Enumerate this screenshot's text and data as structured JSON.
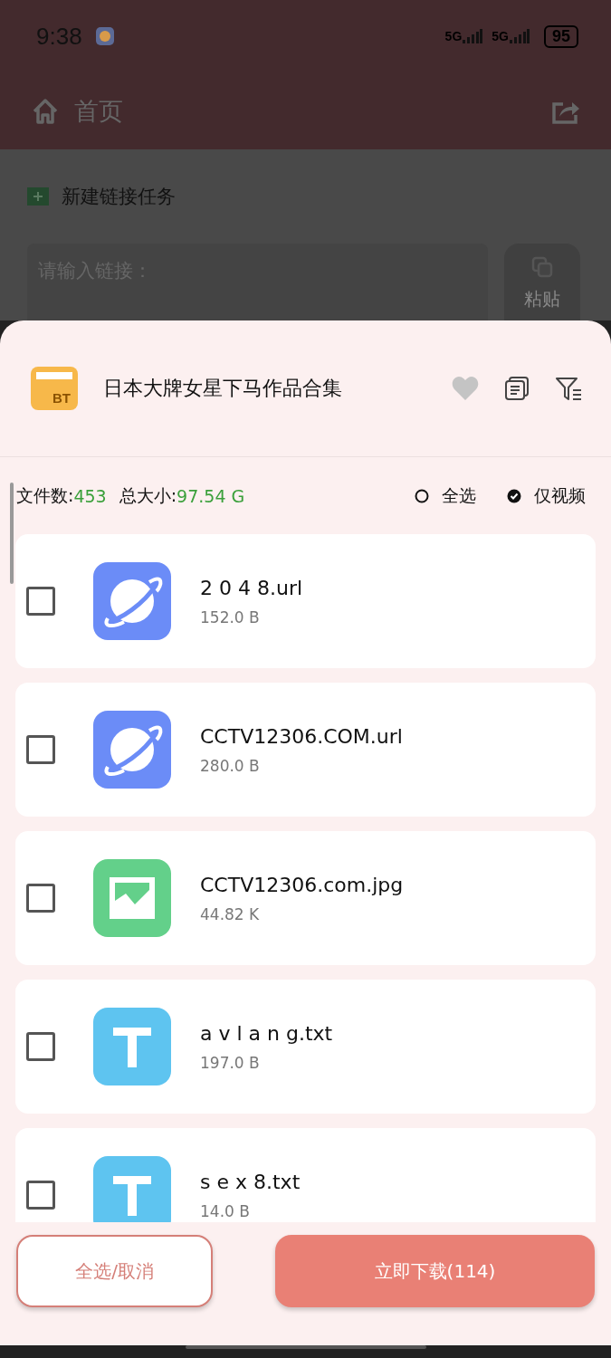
{
  "status_bar": {
    "time": "9:38",
    "networks": [
      "5G",
      "5G"
    ],
    "battery": "95"
  },
  "app_bar": {
    "title": "首页"
  },
  "new_task": {
    "title": "新建链接任务",
    "input": {
      "placeholder": "请输入链接："
    },
    "paste_button": "粘贴"
  },
  "sheet": {
    "icon_label": "BT",
    "title": "日本大牌女星下马作品合集",
    "favorited": false,
    "stats": {
      "count_label": "文件数:",
      "count": "453",
      "size_label": "总大小:",
      "size": "97.54 G"
    },
    "options": [
      {
        "label": "全选",
        "selected": false
      },
      {
        "label": "仅视频",
        "selected": true
      }
    ],
    "files": [
      {
        "kind": "link",
        "name": "2 0 4 8.url",
        "size": "152.0 B",
        "checked": false
      },
      {
        "kind": "link",
        "name": "CCTV12306.COM.url",
        "size": "280.0 B",
        "checked": false
      },
      {
        "kind": "image",
        "name": "CCTV12306.com.jpg",
        "size": "44.82 K",
        "checked": false
      },
      {
        "kind": "text",
        "name": "a v l a n g.txt",
        "size": "197.0 B",
        "checked": false
      },
      {
        "kind": "text",
        "name": "s e x 8.txt",
        "size": "14.0 B",
        "checked": false
      }
    ],
    "buttons": {
      "toggle_all": "全选/取消",
      "download": "立即下载(114)"
    }
  }
}
